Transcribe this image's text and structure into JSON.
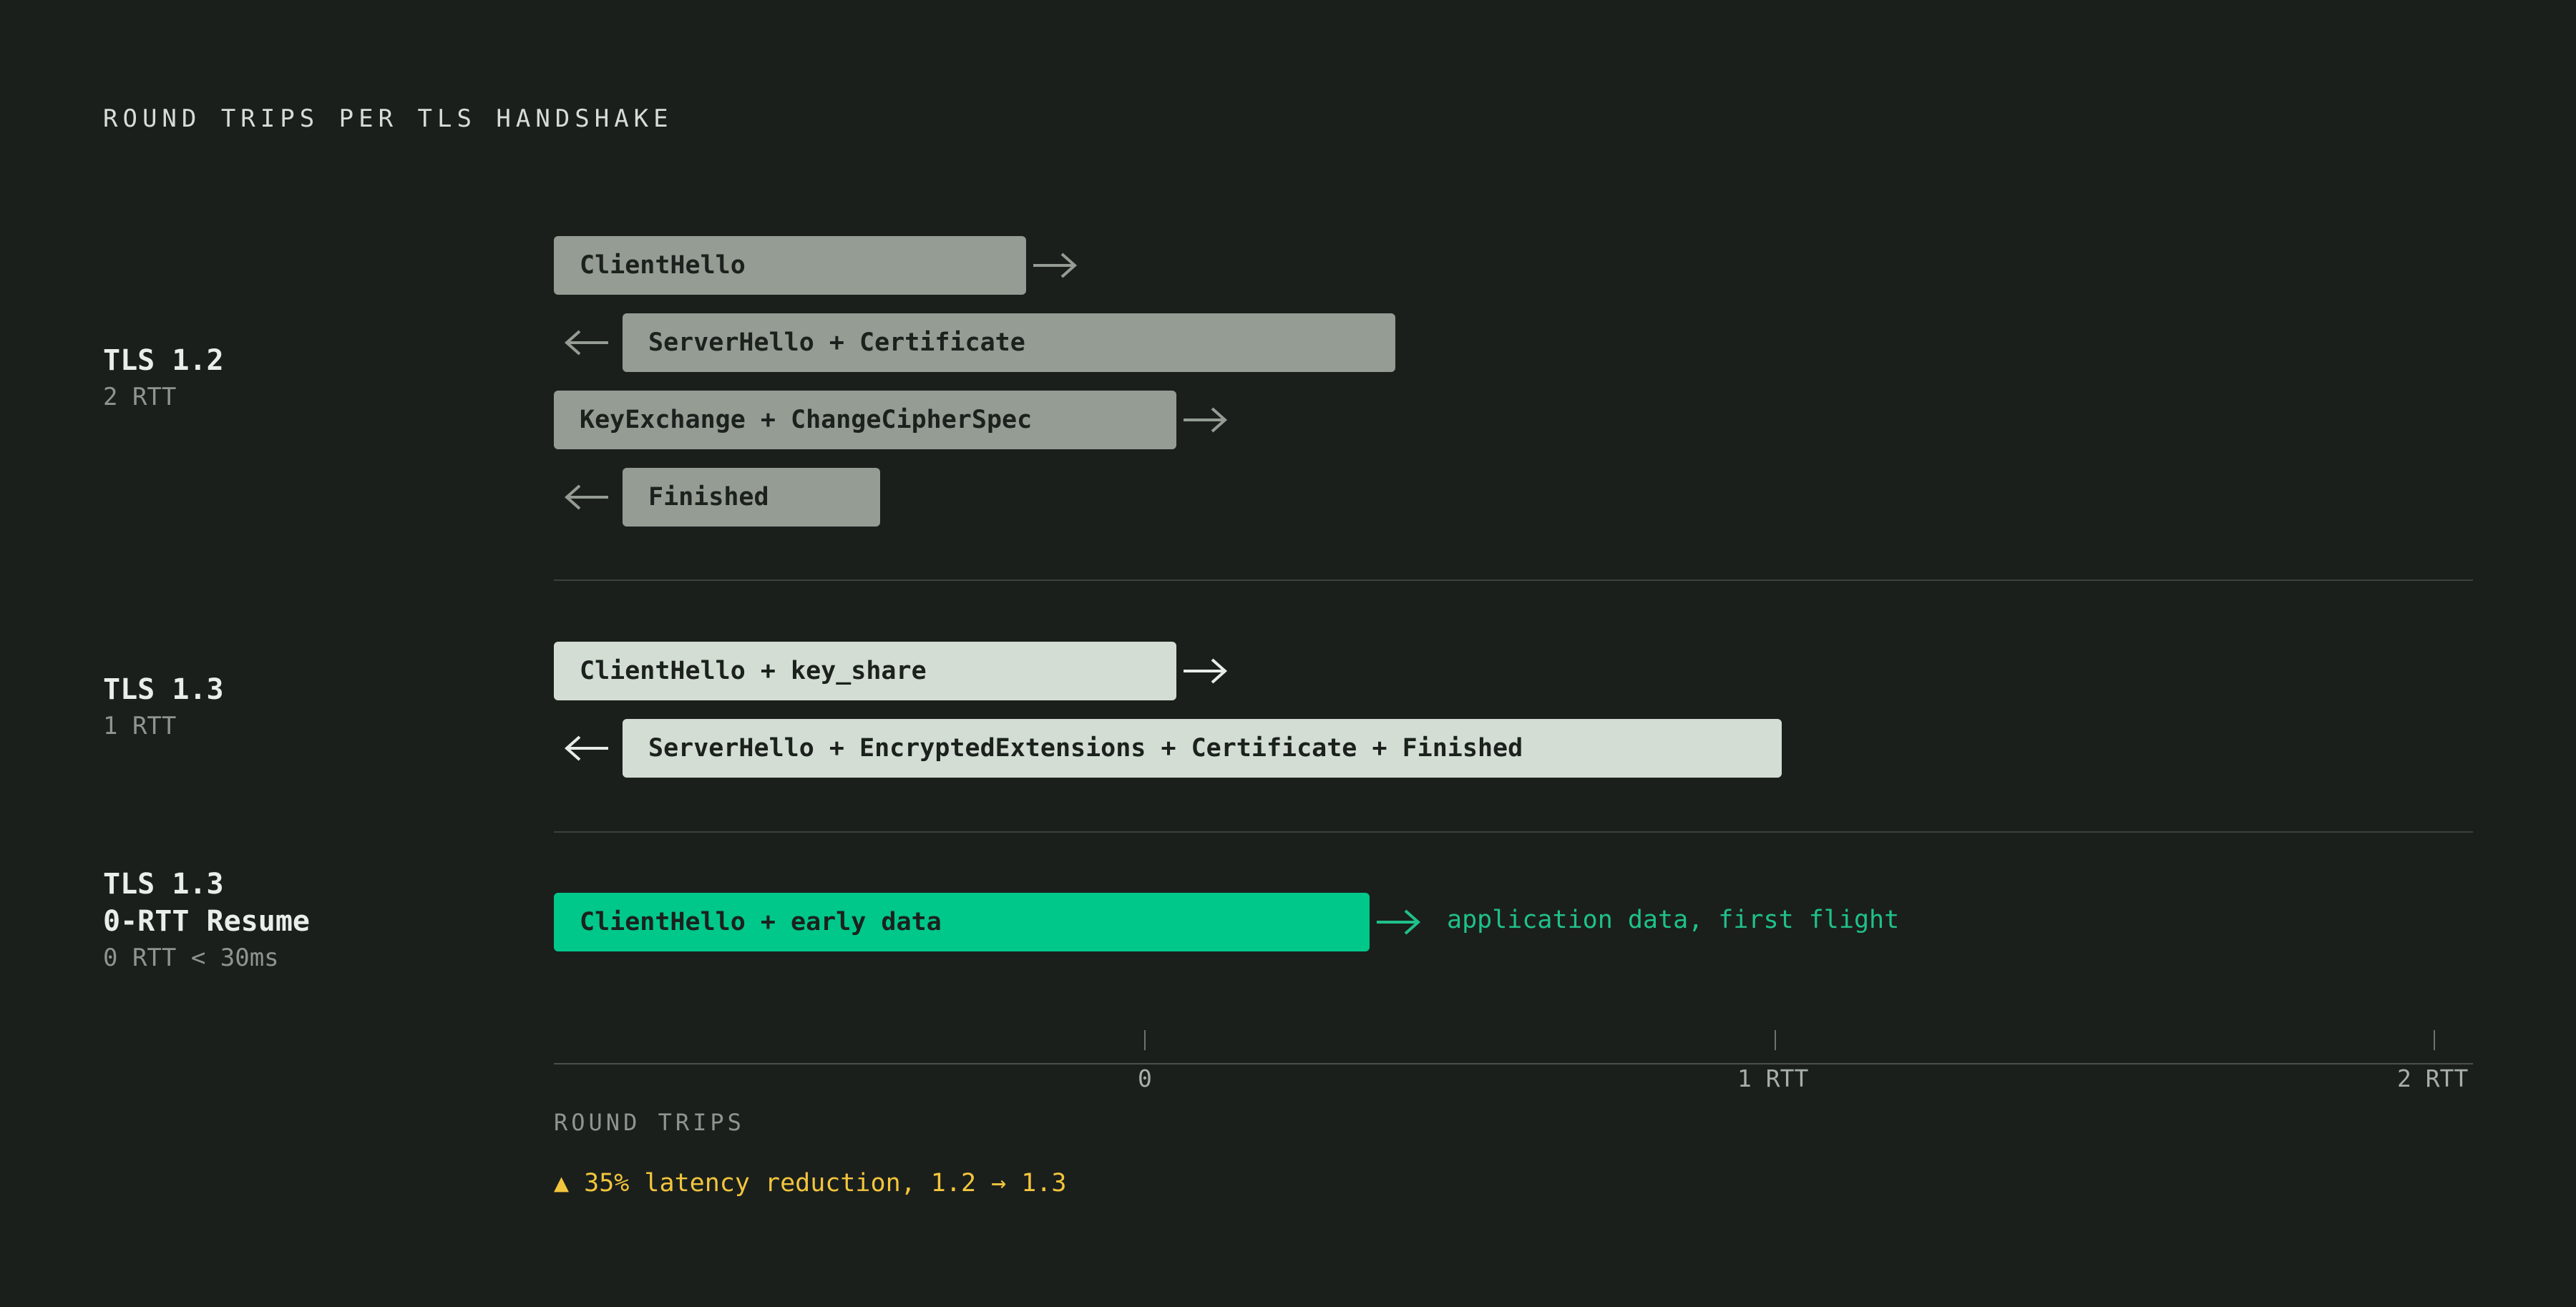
{
  "title": "ROUND TRIPS PER TLS HANDSHAKE",
  "colors": {
    "background": "#1b1f1c",
    "tls12_bar": "#949c93",
    "tls13_bar": "#d3ddd3",
    "zero_rtt_bar": "#00c78a",
    "accent_note": "#1fc18b",
    "callout": "#f2c53d"
  },
  "rows": [
    {
      "name": "TLS 1.2",
      "sub": "2 RTT",
      "messages": [
        {
          "label": "ClientHello",
          "direction": "right-arrow-icon"
        },
        {
          "label": "ServerHello + Certificate",
          "direction": "left-arrow-icon"
        },
        {
          "label": "KeyExchange + ChangeCipherSpec",
          "direction": "right-arrow-icon"
        },
        {
          "label": "Finished",
          "direction": "left-arrow-icon"
        }
      ]
    },
    {
      "name": "TLS 1.3",
      "sub": "1 RTT",
      "messages": [
        {
          "label": "ClientHello + key_share",
          "direction": "right-arrow-icon"
        },
        {
          "label": "ServerHello + EncryptedExtensions + Certificate + Finished",
          "direction": "left-arrow-icon"
        }
      ]
    },
    {
      "name": "TLS 1.3",
      "name2": "0-RTT Resume",
      "sub": "0 RTT < 30ms",
      "messages": [
        {
          "label": "ClientHello + early data",
          "direction": "right-arrow-icon"
        }
      ],
      "note": "application data, first flight"
    }
  ],
  "axis": {
    "title": "ROUND TRIPS",
    "ticks": [
      "0",
      "1 RTT",
      "2 RTT"
    ]
  },
  "callout": "▲ 35% latency reduction, 1.2 → 1.3"
}
